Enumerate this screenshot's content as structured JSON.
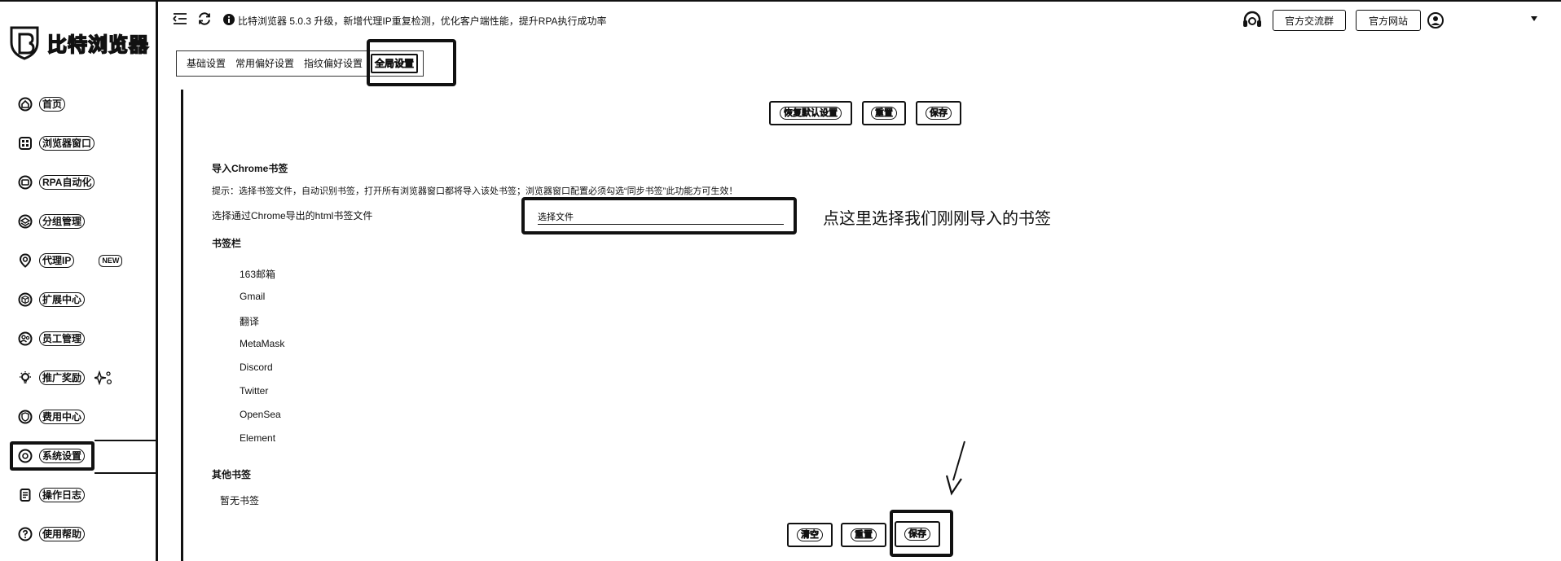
{
  "app": {
    "name": "比特浏览器",
    "notice": "比特浏览器 5.0.3 升级，新增代理IP重复检测，优化客户端性能，提升RPA执行成功率"
  },
  "header": {
    "community_button": "官方交流群",
    "website_button": "官方网站",
    "user_name": ""
  },
  "sidebar": {
    "items": [
      {
        "label": "首页",
        "icon": "home-icon"
      },
      {
        "label": "浏览器窗口",
        "icon": "window-icon"
      },
      {
        "label": "RPA自动化",
        "icon": "robot-icon"
      },
      {
        "label": "分组管理",
        "icon": "layers-icon"
      },
      {
        "label": "代理IP",
        "icon": "location-icon",
        "badge": "NEW"
      },
      {
        "label": "扩展中心",
        "icon": "cube-icon"
      },
      {
        "label": "员工管理",
        "icon": "people-icon"
      },
      {
        "label": "推广奖励",
        "icon": "bulb-icon"
      },
      {
        "label": "费用中心",
        "icon": "shield-icon"
      },
      {
        "label": "系统设置",
        "icon": "gear-icon",
        "active": true
      },
      {
        "label": "操作日志",
        "icon": "doc-icon"
      },
      {
        "label": "使用帮助",
        "icon": "help-icon"
      }
    ]
  },
  "tabs": [
    "基础设置",
    "常用偏好设置",
    "指纹偏好设置",
    "全局设置"
  ],
  "active_tab": "全局设置",
  "actions": {
    "restore_default": "恢复默认设置",
    "reset": "重置",
    "save": "保存",
    "clear": "清空"
  },
  "import": {
    "title": "导入Chrome书签",
    "hint": "提示：选择书签文件，自动识别书签，打开所有浏览器窗口都将导入该处书签；浏览器窗口配置必须勾选“同步书签”此功能方可生效！",
    "field_label": "选择通过Chrome导出的html书签文件",
    "file_placeholder": "选择文件",
    "annotation": "点这里选择我们刚刚导入的书签"
  },
  "bookmarks_bar": {
    "title": "书签栏",
    "items": [
      "163邮箱",
      "Gmail",
      "翻译",
      "MetaMask",
      "Discord",
      "Twitter",
      "OpenSea",
      "Element"
    ]
  },
  "other_bookmarks": {
    "title": "其他书签",
    "empty": "暂无书签"
  },
  "colors": {
    "ink": "#111111",
    "background": "#ffffff"
  }
}
